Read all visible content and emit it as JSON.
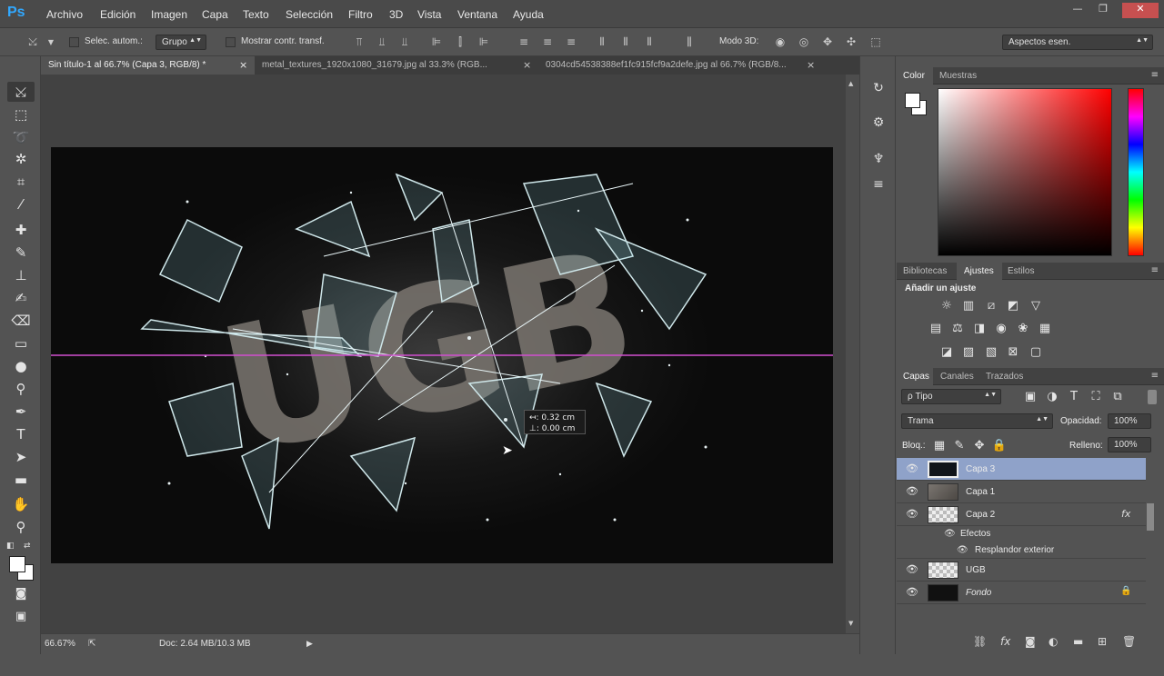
{
  "app": {
    "logo": "Ps"
  },
  "menu": [
    "Archivo",
    "Edición",
    "Imagen",
    "Capa",
    "Texto",
    "Selección",
    "Filtro",
    "3D",
    "Vista",
    "Ventana",
    "Ayuda"
  ],
  "window_controls": {
    "minimize": "—",
    "restore": "❐",
    "close": "✕"
  },
  "options": {
    "auto_select_label": "Selec. autom.:",
    "auto_select_value": "Grupo",
    "show_transform_label": "Mostrar contr. transf.",
    "mode3d_label": "Modo 3D:",
    "workspace": "Aspectos esen."
  },
  "doc_tabs": [
    {
      "title": "Sin título-1 al 66.7% (Capa 3, RGB/8) *",
      "active": true
    },
    {
      "title": "metal_textures_1920x1080_31679.jpg al 33.3% (RGB...",
      "active": false
    },
    {
      "title": "0304cd54538388ef1fc915fcf9a2defe.jpg al 66.7% (RGB/8...",
      "active": false
    }
  ],
  "tab_close": "×",
  "canvas": {
    "art_text": "UGB",
    "measure_w": "↤: 0.32 cm",
    "measure_h": "⊥: 0.00 cm",
    "guide_color": "#d14fd0"
  },
  "status": {
    "zoom": "66.67%",
    "doc": "Doc: 2.64 MB/10.3 MB"
  },
  "color_panel": {
    "tabs": [
      "Color",
      "Muestras"
    ],
    "foreground": "#ffffff",
    "background": "#ffffff",
    "hue": "#ff0000"
  },
  "adjust_panel": {
    "tabs": [
      "Bibliotecas",
      "Ajustes",
      "Estilos"
    ],
    "heading": "Añadir un ajuste",
    "icon_names": [
      "brightness-icon",
      "levels-icon",
      "curves-icon",
      "exposure-icon",
      "vibrance-icon",
      "hue-saturation-icon",
      "color-balance-icon",
      "black-white-icon",
      "photo-filter-icon",
      "channel-mixer-icon",
      "color-lookup-icon",
      "invert-icon",
      "posterize-icon",
      "threshold-icon",
      "gradient-map-icon",
      "selective-color-icon"
    ]
  },
  "layers_panel": {
    "tabs": [
      "Capas",
      "Canales",
      "Trazados"
    ],
    "filter": "ρ Tipo",
    "blend_mode": "Trama",
    "opacity_label": "Opacidad:",
    "opacity_value": "100%",
    "lock_label": "Bloq.:",
    "fill_label": "Relleno:",
    "fill_value": "100%",
    "layers": [
      {
        "name": "Capa 3",
        "selected": true,
        "thumb": "dark"
      },
      {
        "name": "Capa 1",
        "selected": false,
        "thumb": "texture"
      },
      {
        "name": "Capa 2",
        "selected": false,
        "thumb": "transparent",
        "fx": "fx"
      },
      {
        "name": "Efectos",
        "sub": true
      },
      {
        "name": "Resplandor exterior",
        "sub": true
      },
      {
        "name": "UGB",
        "selected": false,
        "thumb": "transparent"
      },
      {
        "name": "Fondo",
        "selected": false,
        "thumb": "black",
        "locked": true
      }
    ]
  }
}
